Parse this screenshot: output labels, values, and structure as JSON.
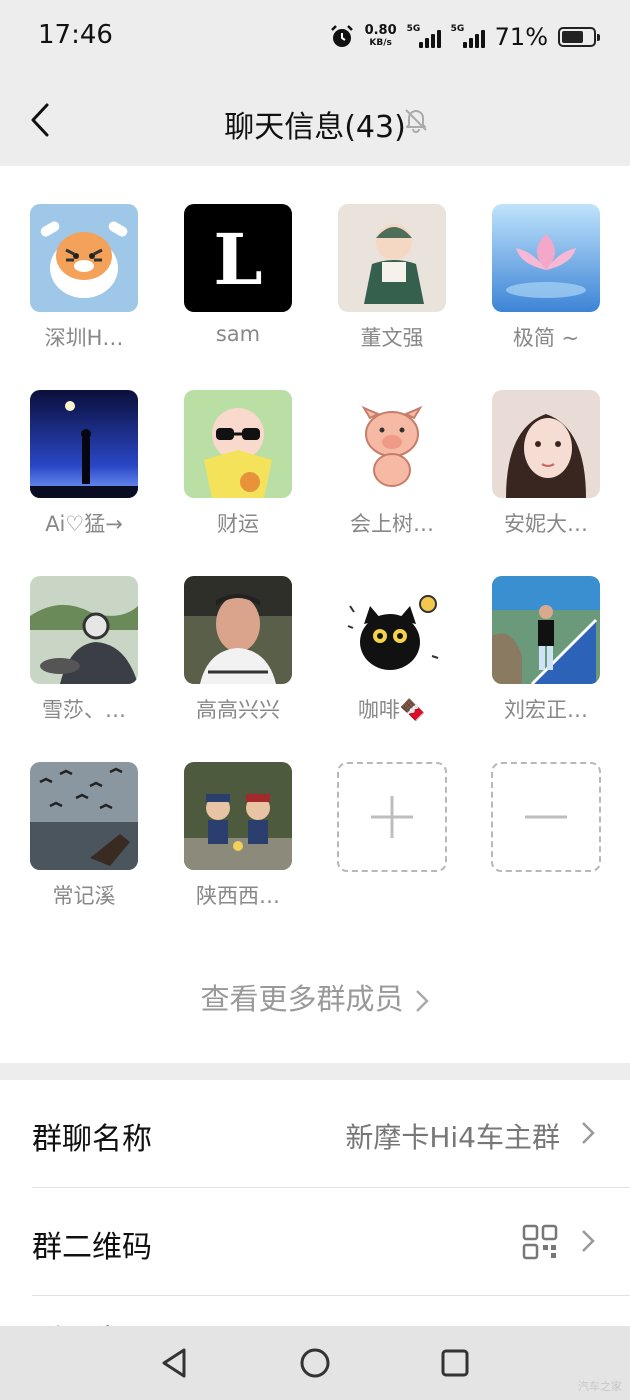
{
  "status_bar": {
    "time": "17:46",
    "net_speed_value": "0.80",
    "net_speed_unit": "KB/s",
    "sim1_label": "5G",
    "sim2_label": "5G",
    "battery_text": "71%",
    "battery_level": 0.71,
    "icons": [
      "alarm-icon",
      "signal-icon",
      "battery-icon"
    ]
  },
  "nav": {
    "back_icon": "chevron-left-icon",
    "title": "聊天信息(43)",
    "mute_icon": "bell-off-icon"
  },
  "members": [
    {
      "name": "深圳H…",
      "avatar": "tiger-cartoon"
    },
    {
      "name": "sam",
      "avatar": "gothic-letter-L"
    },
    {
      "name": "董文强",
      "avatar": "baby-photo"
    },
    {
      "name": "极简 ~",
      "avatar": "lotus-flower"
    },
    {
      "name": "Ai♡猛→",
      "avatar": "night-silhouette"
    },
    {
      "name": "财运",
      "avatar": "cartoon-boy-sunglasses"
    },
    {
      "name": "会上树…",
      "avatar": "cartoon-pig"
    },
    {
      "name": "安妮大…",
      "avatar": "woman-portrait"
    },
    {
      "name": "雪莎、…",
      "avatar": "motorcycle-rider"
    },
    {
      "name": "高高兴兴",
      "avatar": "man-portrait"
    },
    {
      "name": "咖啡🍫",
      "avatar": "black-cat-cartoon"
    },
    {
      "name": "刘宏正…",
      "avatar": "man-on-stairs"
    },
    {
      "name": "常记溪",
      "avatar": "birds-over-water"
    },
    {
      "name": "陕西西…",
      "avatar": "two-figurines"
    }
  ],
  "add_member_icon": "plus-icon",
  "remove_member_icon": "minus-icon",
  "more_members_label": "查看更多群成员",
  "settings": {
    "group_name_label": "群聊名称",
    "group_name_value": "新摩卡Hi4车主群",
    "qr_label": "群二维码",
    "qr_icon": "qr-code-icon",
    "notice_label_partial": "群公告"
  },
  "system_nav": {
    "icons": [
      "back-triangle-icon",
      "home-circle-icon",
      "recents-square-icon"
    ]
  },
  "watermark": "汽车之家",
  "colors": {
    "background": "#ededed",
    "card": "#ffffff",
    "text_primary": "#111111",
    "text_secondary": "#888888"
  }
}
